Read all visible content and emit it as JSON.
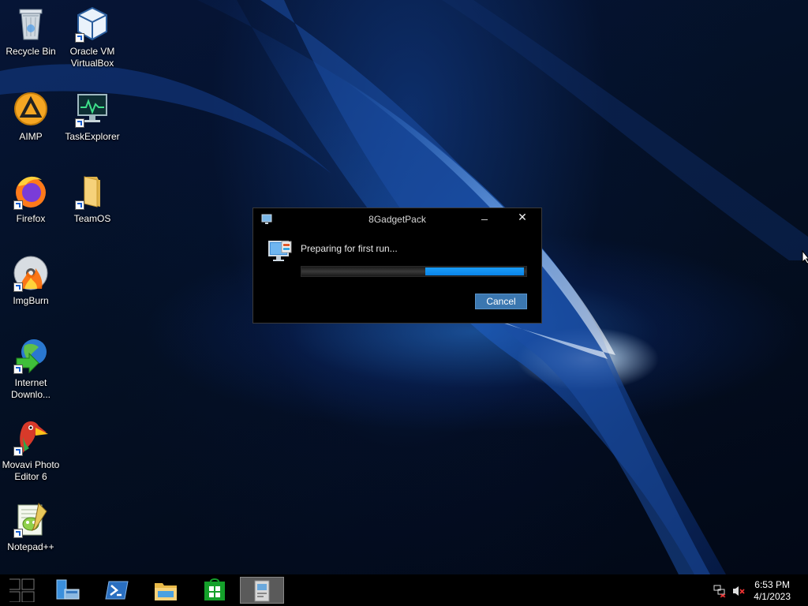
{
  "desktop": {
    "icons": [
      {
        "label": "Recycle Bin",
        "icon": "recycle-bin-icon"
      },
      {
        "label": "Oracle VM VirtualBox",
        "icon": "virtualbox-icon"
      },
      {
        "label": "AIMP",
        "icon": "aimp-icon"
      },
      {
        "label": "TaskExplorer",
        "icon": "task-explorer-icon"
      },
      {
        "label": "Firefox",
        "icon": "firefox-icon"
      },
      {
        "label": "TeamOS",
        "icon": "folder-icon"
      },
      {
        "label": "ImgBurn",
        "icon": "imgburn-icon"
      },
      {
        "label": "Internet Downlo...",
        "icon": "internet-download-manager-icon"
      },
      {
        "label": "Movavi Photo Editor 6",
        "icon": "movavi-photo-editor-icon"
      },
      {
        "label": "Notepad++",
        "icon": "notepad-plus-plus-icon"
      }
    ]
  },
  "dialog": {
    "title": "8GadgetPack",
    "message": "Preparing for first run...",
    "progress_fraction": 0.44,
    "minimize_label": "_",
    "close_label": "✕",
    "cancel_label": "Cancel"
  },
  "taskbar": {
    "items": [
      {
        "icon": "start-button-icon"
      },
      {
        "icon": "server-manager-icon"
      },
      {
        "icon": "powershell-icon"
      },
      {
        "icon": "file-explorer-icon"
      },
      {
        "icon": "store-icon"
      },
      {
        "icon": "8gadgetpack-installer-icon"
      }
    ],
    "tray": [
      {
        "icon": "network-icon"
      },
      {
        "icon": "volume-muted-icon"
      }
    ],
    "time": "6:53 PM",
    "date": "4/1/2023"
  },
  "colors": {
    "accent": "#0a84e8",
    "cancel_button": "#3b77b0",
    "desktop_base": "#041024"
  }
}
